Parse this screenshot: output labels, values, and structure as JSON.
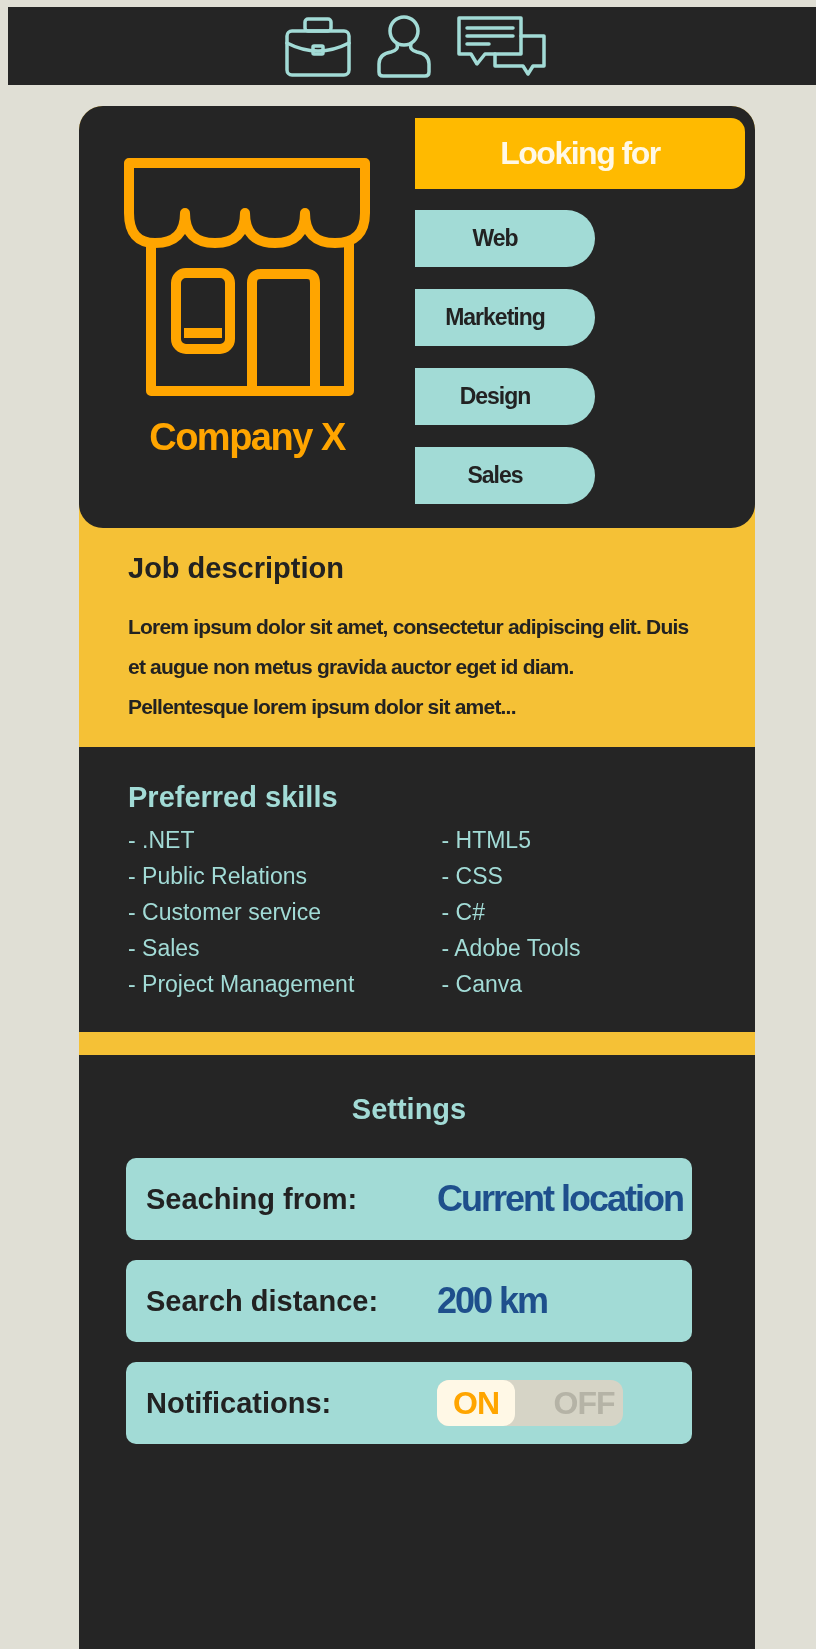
{
  "company": {
    "name": "Company X"
  },
  "looking_for": {
    "title": "Looking for",
    "items": [
      "Web",
      "Marketing",
      "Design",
      "Sales"
    ]
  },
  "job_description": {
    "title": "Job description",
    "text": "Lorem ipsum dolor sit amet, consectetur adipiscing elit. Duis et augue non metus gravida auctor eget id diam. Pellentesque lorem ipsum dolor sit amet..."
  },
  "preferred_skills": {
    "title": "Preferred skills",
    "column_1": [
      "- .NET",
      "- Public Relations",
      "- Customer service",
      "- Sales",
      "- Project Management"
    ],
    "column_2": [
      "- HTML5",
      "- CSS",
      "- C#",
      "- Adobe Tools",
      "- Canva"
    ]
  },
  "settings": {
    "title": "Settings",
    "rows": [
      {
        "kind": "value",
        "label": "Seaching from:",
        "value": "Current location"
      },
      {
        "kind": "value",
        "label": "Search distance:",
        "value": "200 km"
      },
      {
        "kind": "toggle",
        "label": "Notifications:",
        "on": true,
        "on_text": "ON",
        "off_text": "OFF"
      }
    ]
  }
}
